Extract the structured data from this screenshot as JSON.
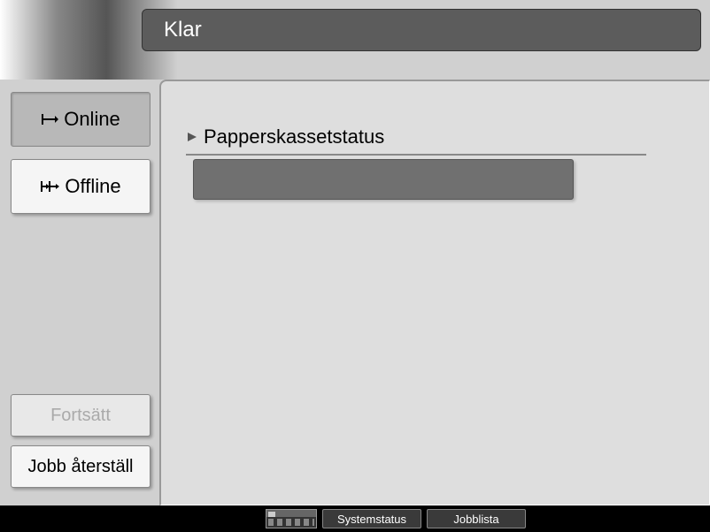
{
  "header": {
    "title": "Klar"
  },
  "sidebar": {
    "online_label": "Online",
    "offline_label": "Offline",
    "continue_label": "Fortsätt",
    "jobreset_label": "Jobb återställ"
  },
  "content": {
    "section_title": "Papperskassetstatus"
  },
  "bottombar": {
    "systemstatus_label": "Systemstatus",
    "joblist_label": "Jobblista"
  }
}
